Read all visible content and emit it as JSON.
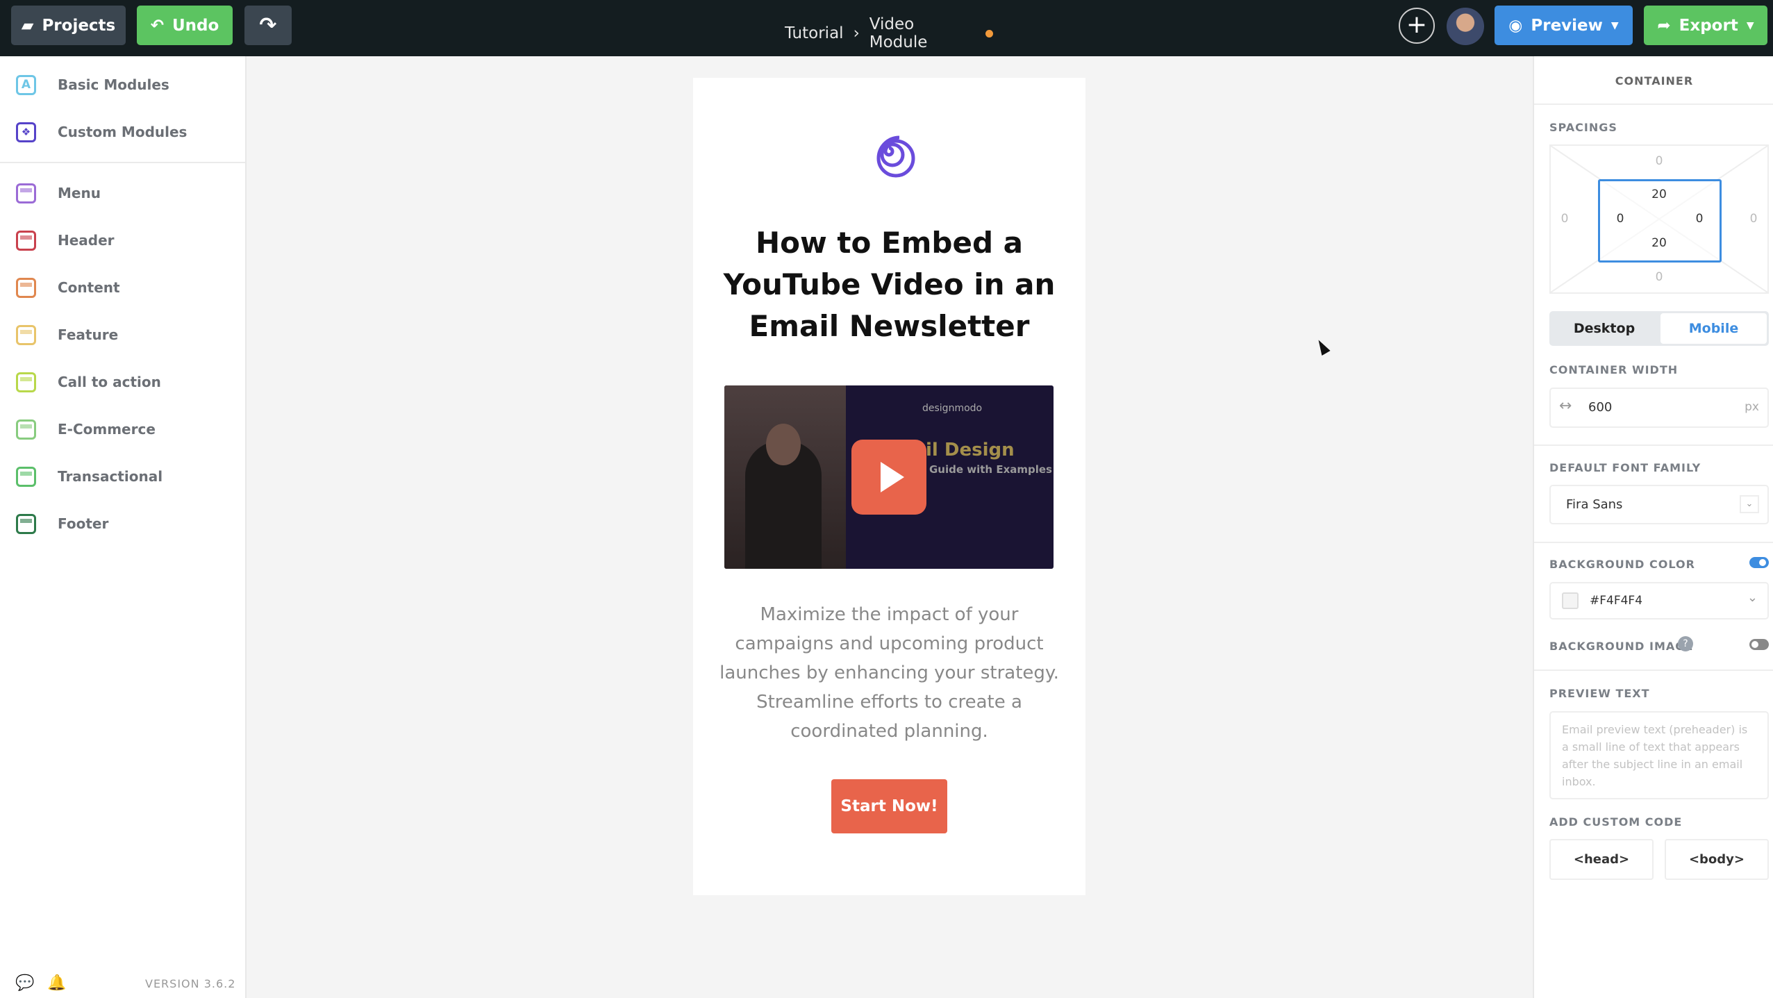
{
  "topbar": {
    "projects": "Projects",
    "undo": "Undo",
    "breadcrumb": [
      "Tutorial",
      "Video Module"
    ],
    "preview": "Preview",
    "export": "Export",
    "colors": {
      "bar": "#141d20",
      "undo": "#5cc461",
      "preview": "#3d8de0",
      "export": "#5cc461",
      "unsaved_dot": "#f29a3b"
    }
  },
  "sidebar": {
    "top_items": [
      {
        "label": "Basic Modules",
        "color": "#6ec6e6"
      },
      {
        "label": "Custom Modules",
        "color": "#5643c9"
      }
    ],
    "items": [
      {
        "label": "Menu",
        "color": "#9b6bd6"
      },
      {
        "label": "Header",
        "color": "#c9414d"
      },
      {
        "label": "Content",
        "color": "#e0874f"
      },
      {
        "label": "Feature",
        "color": "#e8c46a"
      },
      {
        "label": "Call to action",
        "color": "#b8d84a"
      },
      {
        "label": "E-Commerce",
        "color": "#88cc7f"
      },
      {
        "label": "Transactional",
        "color": "#5bbf6a"
      },
      {
        "label": "Footer",
        "color": "#2d7a4a"
      }
    ],
    "version": "VERSION 3.6.2"
  },
  "email": {
    "title": [
      "How to Embed a",
      "YouTube Video in an",
      "Email Newsletter"
    ],
    "video": {
      "brand": "designmodo",
      "headline": "il Design",
      "subhead": "Guide with Examples"
    },
    "paragraph": [
      "Maximize the impact of your",
      "campaigns and upcoming product",
      "launches by enhancing your strategy.",
      "Streamline efforts to create a",
      "coordinated planning."
    ],
    "cta": "Start Now!",
    "accent": "#e8644b"
  },
  "panel": {
    "heading": "CONTAINER",
    "spacings_label": "SPACINGS",
    "spacing": {
      "margin": {
        "top": "0",
        "right": "0",
        "bottom": "0",
        "left": "0"
      },
      "padding": {
        "top": "20",
        "right": "0",
        "bottom": "20",
        "left": "0"
      }
    },
    "tabs": [
      "Desktop",
      "Mobile"
    ],
    "active_tab": "Mobile",
    "width_label": "CONTAINER WIDTH",
    "width_value": "600",
    "width_unit": "px",
    "font_label": "DEFAULT FONT FAMILY",
    "font_value": "Fira Sans",
    "bg_color_label": "BACKGROUND COLOR",
    "bg_color_on": true,
    "bg_color_value": "#F4F4F4",
    "bg_image_label": "BACKGROUND IMAGE",
    "bg_image_on": false,
    "preview_label": "PREVIEW TEXT",
    "preview_placeholder": "Email preview text (preheader) is a small line of text that appears after the subject line in an email inbox.",
    "code_label": "ADD CUSTOM CODE",
    "code_head": "<head>",
    "code_body": "<body>"
  }
}
